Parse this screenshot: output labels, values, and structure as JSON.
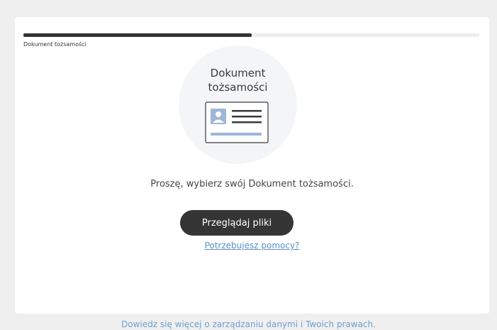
{
  "progress": {
    "step_label": "Dokument tożsamości",
    "fraction": 0.5
  },
  "document": {
    "title_line1": "Dokument",
    "title_line2": "tożsamości",
    "icon": "id-card-icon"
  },
  "instruction": "Proszę, wybierz swój Dokument tożsamości.",
  "browse_button_label": "Przeglądaj pliki",
  "help_link_label": "Potrzebujesz pomocy?",
  "footer_link_label": "Dowiedz się więcej o zarządzaniu danymi i Twoich prawach.",
  "colors": {
    "primary_button": "#353535",
    "link": "#5b8fc7",
    "icon_accent": "#9fb6d6"
  }
}
